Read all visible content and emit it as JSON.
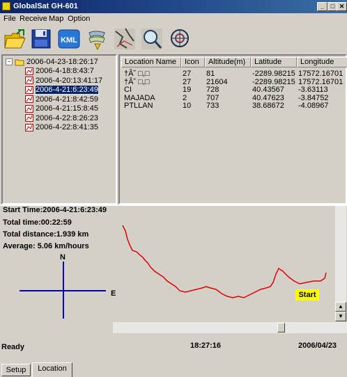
{
  "window": {
    "title": "GlobalSat GH-601",
    "minimize": "_",
    "maximize": "□",
    "close": "✕"
  },
  "menu": [
    "File",
    "Receive",
    "Map",
    "Option"
  ],
  "toolbar": [
    {
      "name": "open-folder-icon"
    },
    {
      "name": "save-disk-icon"
    },
    {
      "name": "kml-export-icon",
      "label": "KML"
    },
    {
      "name": "map-layer-icon"
    },
    {
      "name": "route-map-icon"
    },
    {
      "name": "zoom-search-icon"
    },
    {
      "name": "globe-settings-icon"
    }
  ],
  "tree": {
    "root": "2006-04-23-18:26:17",
    "expander": "−",
    "tracks": [
      "2006-4-18:8:43:7",
      "2006-4-20:13:41:17",
      "2006-4-21:6:23:49",
      "2006-4-21:8:42:59",
      "2006-4-21:15:8:45",
      "2006-4-22:8:26:23",
      "2006-4-22:8:41:35"
    ],
    "selected_index": 2
  },
  "locations": {
    "columns": [
      "Location Name",
      "Icon",
      "Altitude(m)",
      "Latitude",
      "Longitude"
    ],
    "rows": [
      [
        "†Â˘ □,□",
        "27",
        "81",
        "-2289.98215",
        "17572.16701"
      ],
      [
        "†Â˘ □,□",
        "27",
        "21604",
        "-2289.98215",
        "17572.16701"
      ],
      [
        "CI",
        "19",
        "728",
        "40.43567",
        "-3.63113"
      ],
      [
        "MAJADA",
        "2",
        "707",
        "40.47623",
        "-3.84752"
      ],
      [
        "PTLLAN",
        "10",
        "733",
        "38.68672",
        "-4.08967"
      ]
    ]
  },
  "stats": {
    "start_time": "Start Time:2006-4-21:6:23:49",
    "total_time": "Total time:00:22:59",
    "total_distance": "Total distance:1.939 km",
    "average": "Average: 5.06 km/hours"
  },
  "map": {
    "north_label": "N",
    "east_label": "E",
    "start_label": "Start",
    "track_color": "#e00000",
    "compass_color": "#0000c0"
  },
  "status": {
    "state": "Ready",
    "time": "18:27:16",
    "date": "2006/04/23"
  },
  "tabs": [
    {
      "label": "Setup",
      "active": false
    },
    {
      "label": "Location",
      "active": true
    }
  ]
}
